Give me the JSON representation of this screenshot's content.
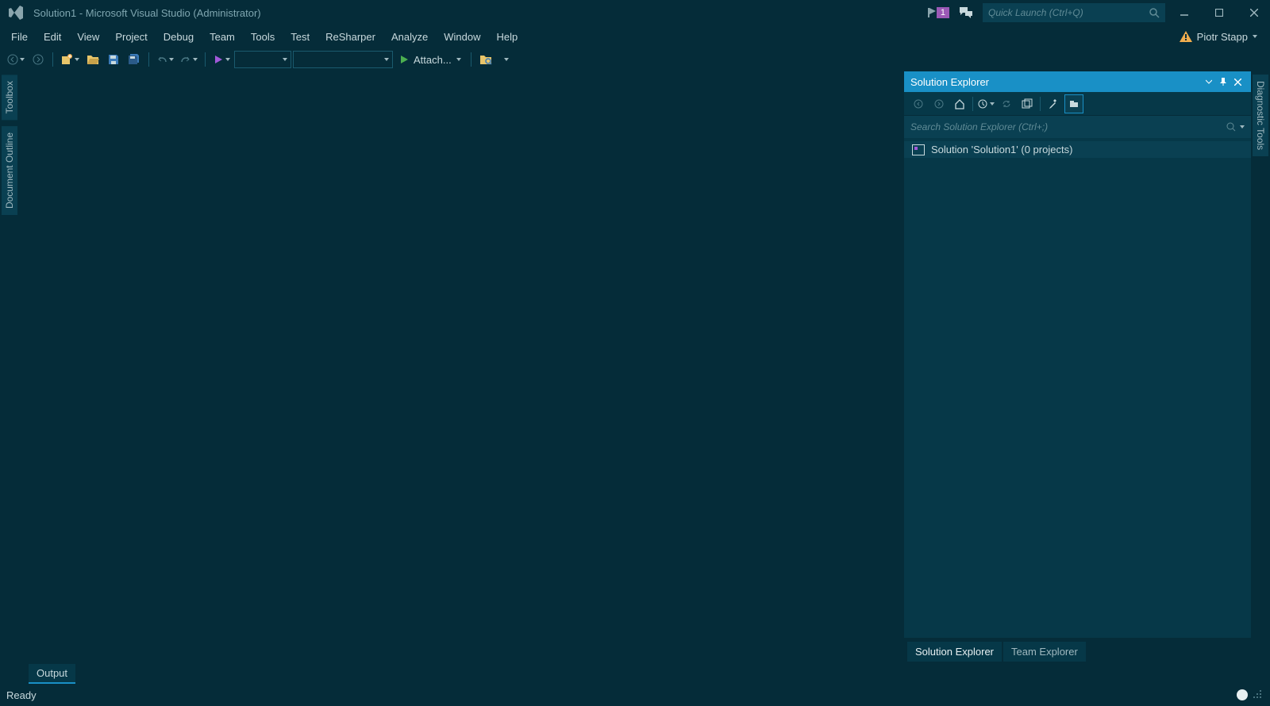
{
  "title": "Solution1 - Microsoft Visual Studio (Administrator)",
  "notifications": {
    "count": "1"
  },
  "quick_launch": {
    "placeholder": "Quick Launch (Ctrl+Q)"
  },
  "user": {
    "name": "Piotr Stapp"
  },
  "menu": [
    "File",
    "Edit",
    "View",
    "Project",
    "Debug",
    "Team",
    "Tools",
    "Test",
    "ReSharper",
    "Analyze",
    "Window",
    "Help"
  ],
  "toolbar": {
    "attach_label": "Attach..."
  },
  "left_tabs": [
    "Toolbox",
    "Document Outline"
  ],
  "right_tabs": [
    "Diagnostic Tools"
  ],
  "solution_explorer": {
    "title": "Solution Explorer",
    "search_placeholder": "Search Solution Explorer (Ctrl+;)",
    "root_label": "Solution 'Solution1' (0 projects)"
  },
  "bottom_tabs": {
    "solution_explorer": "Solution Explorer",
    "team_explorer": "Team Explorer"
  },
  "output_tab": "Output",
  "status": "Ready"
}
